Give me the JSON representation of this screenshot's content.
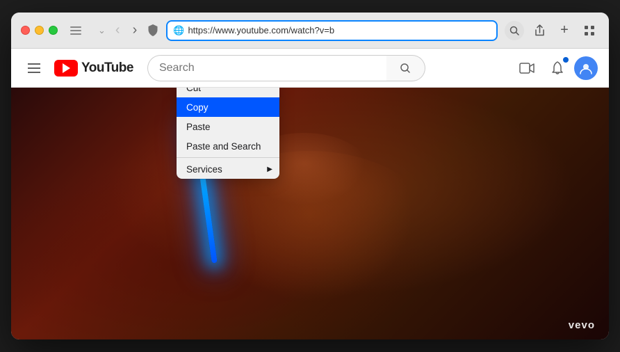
{
  "browser": {
    "title": "YouTube",
    "url": "https://www.youtube.com/watch?v=b",
    "url_display": "https://www.youtube.com/watch?v=b"
  },
  "traffic_lights": {
    "red_label": "close",
    "yellow_label": "minimize",
    "green_label": "maximize"
  },
  "youtube": {
    "logo_text": "YouTube",
    "search_placeholder": "Search",
    "search_value": ""
  },
  "context_menu": {
    "items": [
      {
        "id": "cut",
        "label": "Cut",
        "selected": false,
        "disabled": false,
        "has_submenu": false
      },
      {
        "id": "copy",
        "label": "Copy",
        "selected": true,
        "disabled": false,
        "has_submenu": false
      },
      {
        "id": "paste",
        "label": "Paste",
        "selected": false,
        "disabled": false,
        "has_submenu": false
      },
      {
        "id": "paste-search",
        "label": "Paste and Search",
        "selected": false,
        "disabled": false,
        "has_submenu": false
      },
      {
        "id": "services",
        "label": "Services",
        "selected": false,
        "disabled": false,
        "has_submenu": true
      }
    ]
  },
  "video": {
    "vevo_label": "vevo"
  },
  "icons": {
    "sidebar_toggle": "⊞",
    "back": "‹",
    "forward": "›",
    "shield": "🛡",
    "share": "⬆",
    "new_tab": "+",
    "extensions": "⊞",
    "search": "🔍",
    "mic": "🎤",
    "bell": "🔔",
    "camera": "📷",
    "hamburger": "☰"
  }
}
